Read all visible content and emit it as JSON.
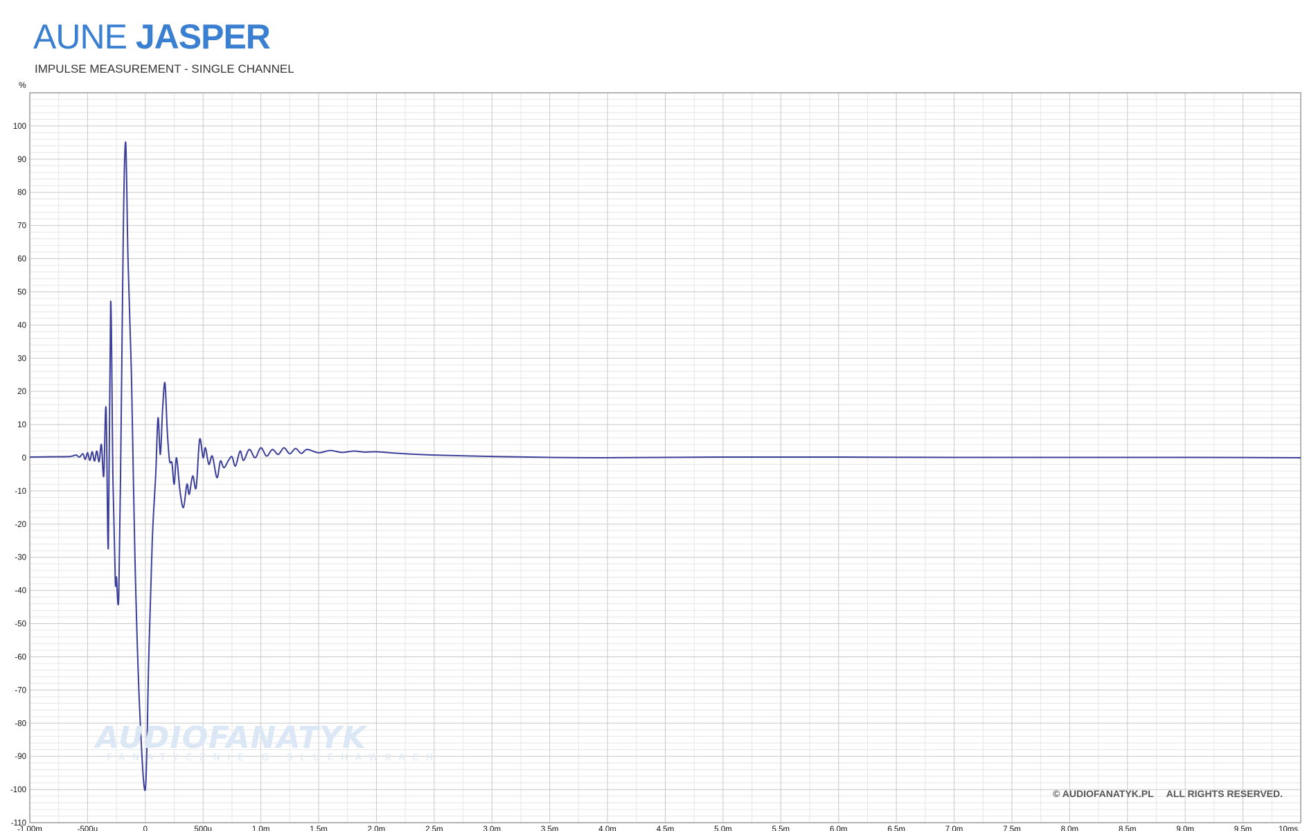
{
  "header": {
    "brand": "AUNE",
    "model": "JASPER",
    "subtitle": "IMPULSE MEASUREMENT  -  SINGLE CHANNEL"
  },
  "footer": {
    "site": "© AUDIOFANATYK.PL",
    "rights": "ALL RIGHTS RESERVED."
  },
  "watermark": {
    "main": "AUDIOFANATYK",
    "sub": "FANATYCZNIE O SŁUCHAWKACH"
  },
  "colors": {
    "brand": "#3a7fd0",
    "series": "#3b3f9a",
    "grid_major": "#c8c8c8",
    "grid_minor": "#e6e6e6"
  },
  "chart_data": {
    "type": "line",
    "ylabel": "%",
    "xlim": [
      -1.0,
      10.0
    ],
    "ylim": [
      -110,
      110
    ],
    "x_unit": "ms",
    "grid": true,
    "x_ticks": [
      {
        "v": -1.0,
        "label": "-1,00m"
      },
      {
        "v": -0.5,
        "label": "-500u"
      },
      {
        "v": 0.0,
        "label": "0"
      },
      {
        "v": 0.5,
        "label": "500u"
      },
      {
        "v": 1.0,
        "label": "1,0m"
      },
      {
        "v": 1.5,
        "label": "1,5m"
      },
      {
        "v": 2.0,
        "label": "2,0m"
      },
      {
        "v": 2.5,
        "label": "2,5m"
      },
      {
        "v": 3.0,
        "label": "3,0m"
      },
      {
        "v": 3.5,
        "label": "3,5m"
      },
      {
        "v": 4.0,
        "label": "4,0m"
      },
      {
        "v": 4.5,
        "label": "4,5m"
      },
      {
        "v": 5.0,
        "label": "5,0m"
      },
      {
        "v": 5.5,
        "label": "5,5m"
      },
      {
        "v": 6.0,
        "label": "6,0m"
      },
      {
        "v": 6.5,
        "label": "6,5m"
      },
      {
        "v": 7.0,
        "label": "7,0m"
      },
      {
        "v": 7.5,
        "label": "7,5m"
      },
      {
        "v": 8.0,
        "label": "8,0m"
      },
      {
        "v": 8.5,
        "label": "8,5m"
      },
      {
        "v": 9.0,
        "label": "9,0m"
      },
      {
        "v": 9.5,
        "label": "9,5m"
      },
      {
        "v": 10.0,
        "label": "10ms"
      }
    ],
    "y_ticks": [
      {
        "v": 100,
        "label": "100"
      },
      {
        "v": 90,
        "label": "90"
      },
      {
        "v": 80,
        "label": "80"
      },
      {
        "v": 70,
        "label": "70"
      },
      {
        "v": 60,
        "label": "60"
      },
      {
        "v": 50,
        "label": "50"
      },
      {
        "v": 40,
        "label": "40"
      },
      {
        "v": 30,
        "label": "30"
      },
      {
        "v": 20,
        "label": "20"
      },
      {
        "v": 10,
        "label": "10"
      },
      {
        "v": 0,
        "label": "0"
      },
      {
        "v": -10,
        "label": "-10"
      },
      {
        "v": -20,
        "label": "-20"
      },
      {
        "v": -30,
        "label": "-30"
      },
      {
        "v": -40,
        "label": "-40"
      },
      {
        "v": -50,
        "label": "-50"
      },
      {
        "v": -60,
        "label": "-60"
      },
      {
        "v": -70,
        "label": "-70"
      },
      {
        "v": -80,
        "label": "-80"
      },
      {
        "v": -90,
        "label": "-90"
      },
      {
        "v": -100,
        "label": "-100"
      },
      {
        "v": -110,
        "label": "-110"
      }
    ],
    "series": [
      {
        "points": [
          [
            -1.0,
            0.2
          ],
          [
            -0.8,
            0.3
          ],
          [
            -0.65,
            0.4
          ],
          [
            -0.6,
            0.8
          ],
          [
            -0.57,
            0.2
          ],
          [
            -0.54,
            1.2
          ],
          [
            -0.52,
            -0.5
          ],
          [
            -0.5,
            1.5
          ],
          [
            -0.48,
            -0.8
          ],
          [
            -0.46,
            1.8
          ],
          [
            -0.44,
            -1.0
          ],
          [
            -0.42,
            2.0
          ],
          [
            -0.4,
            -1.2
          ],
          [
            -0.38,
            4.0
          ],
          [
            -0.36,
            -5.5
          ],
          [
            -0.34,
            15.0
          ],
          [
            -0.32,
            -27.0
          ],
          [
            -0.3,
            47.0
          ],
          [
            -0.28,
            -7.0
          ],
          [
            -0.26,
            -37.0
          ],
          [
            -0.25,
            -36.0
          ],
          [
            -0.23,
            -42.0
          ],
          [
            -0.21,
            8.0
          ],
          [
            -0.19,
            70.0
          ],
          [
            -0.17,
            95.0
          ],
          [
            -0.15,
            60.0
          ],
          [
            -0.12,
            25.0
          ],
          [
            -0.09,
            -30.0
          ],
          [
            -0.05,
            -75.0
          ],
          [
            0.0,
            -100.0
          ],
          [
            0.03,
            -60.0
          ],
          [
            0.06,
            -25.0
          ],
          [
            0.09,
            -5.0
          ],
          [
            0.11,
            12.0
          ],
          [
            0.13,
            1.0
          ],
          [
            0.15,
            15.0
          ],
          [
            0.17,
            22.5
          ],
          [
            0.19,
            8.0
          ],
          [
            0.21,
            -1.0
          ],
          [
            0.23,
            -1.5
          ],
          [
            0.25,
            -8.0
          ],
          [
            0.27,
            0.0
          ],
          [
            0.3,
            -10.0
          ],
          [
            0.33,
            -15.0
          ],
          [
            0.36,
            -8.0
          ],
          [
            0.38,
            -11.0
          ],
          [
            0.41,
            -5.5
          ],
          [
            0.44,
            -9.0
          ],
          [
            0.47,
            5.5
          ],
          [
            0.5,
            0.0
          ],
          [
            0.52,
            3.0
          ],
          [
            0.55,
            -2.0
          ],
          [
            0.58,
            0.5
          ],
          [
            0.62,
            -6.0
          ],
          [
            0.65,
            -1.0
          ],
          [
            0.68,
            -3.0
          ],
          [
            0.72,
            -0.8
          ],
          [
            0.75,
            0.3
          ],
          [
            0.78,
            -2.5
          ],
          [
            0.82,
            2.0
          ],
          [
            0.85,
            -0.8
          ],
          [
            0.9,
            2.5
          ],
          [
            0.95,
            0.0
          ],
          [
            1.0,
            3.0
          ],
          [
            1.05,
            0.5
          ],
          [
            1.1,
            2.5
          ],
          [
            1.15,
            1.0
          ],
          [
            1.2,
            3.0
          ],
          [
            1.25,
            1.2
          ],
          [
            1.3,
            2.8
          ],
          [
            1.35,
            1.3
          ],
          [
            1.4,
            2.5
          ],
          [
            1.5,
            1.5
          ],
          [
            1.6,
            2.2
          ],
          [
            1.7,
            1.6
          ],
          [
            1.8,
            2.0
          ],
          [
            1.9,
            1.7
          ],
          [
            2.0,
            1.8
          ],
          [
            2.2,
            1.3
          ],
          [
            2.5,
            0.8
          ],
          [
            3.0,
            0.4
          ],
          [
            3.5,
            0.1
          ],
          [
            4.0,
            0.0
          ],
          [
            5.0,
            0.2
          ],
          [
            6.0,
            0.2
          ],
          [
            7.0,
            0.1
          ],
          [
            8.0,
            0.1
          ],
          [
            9.0,
            0.1
          ],
          [
            10.0,
            0.0
          ]
        ]
      }
    ]
  }
}
